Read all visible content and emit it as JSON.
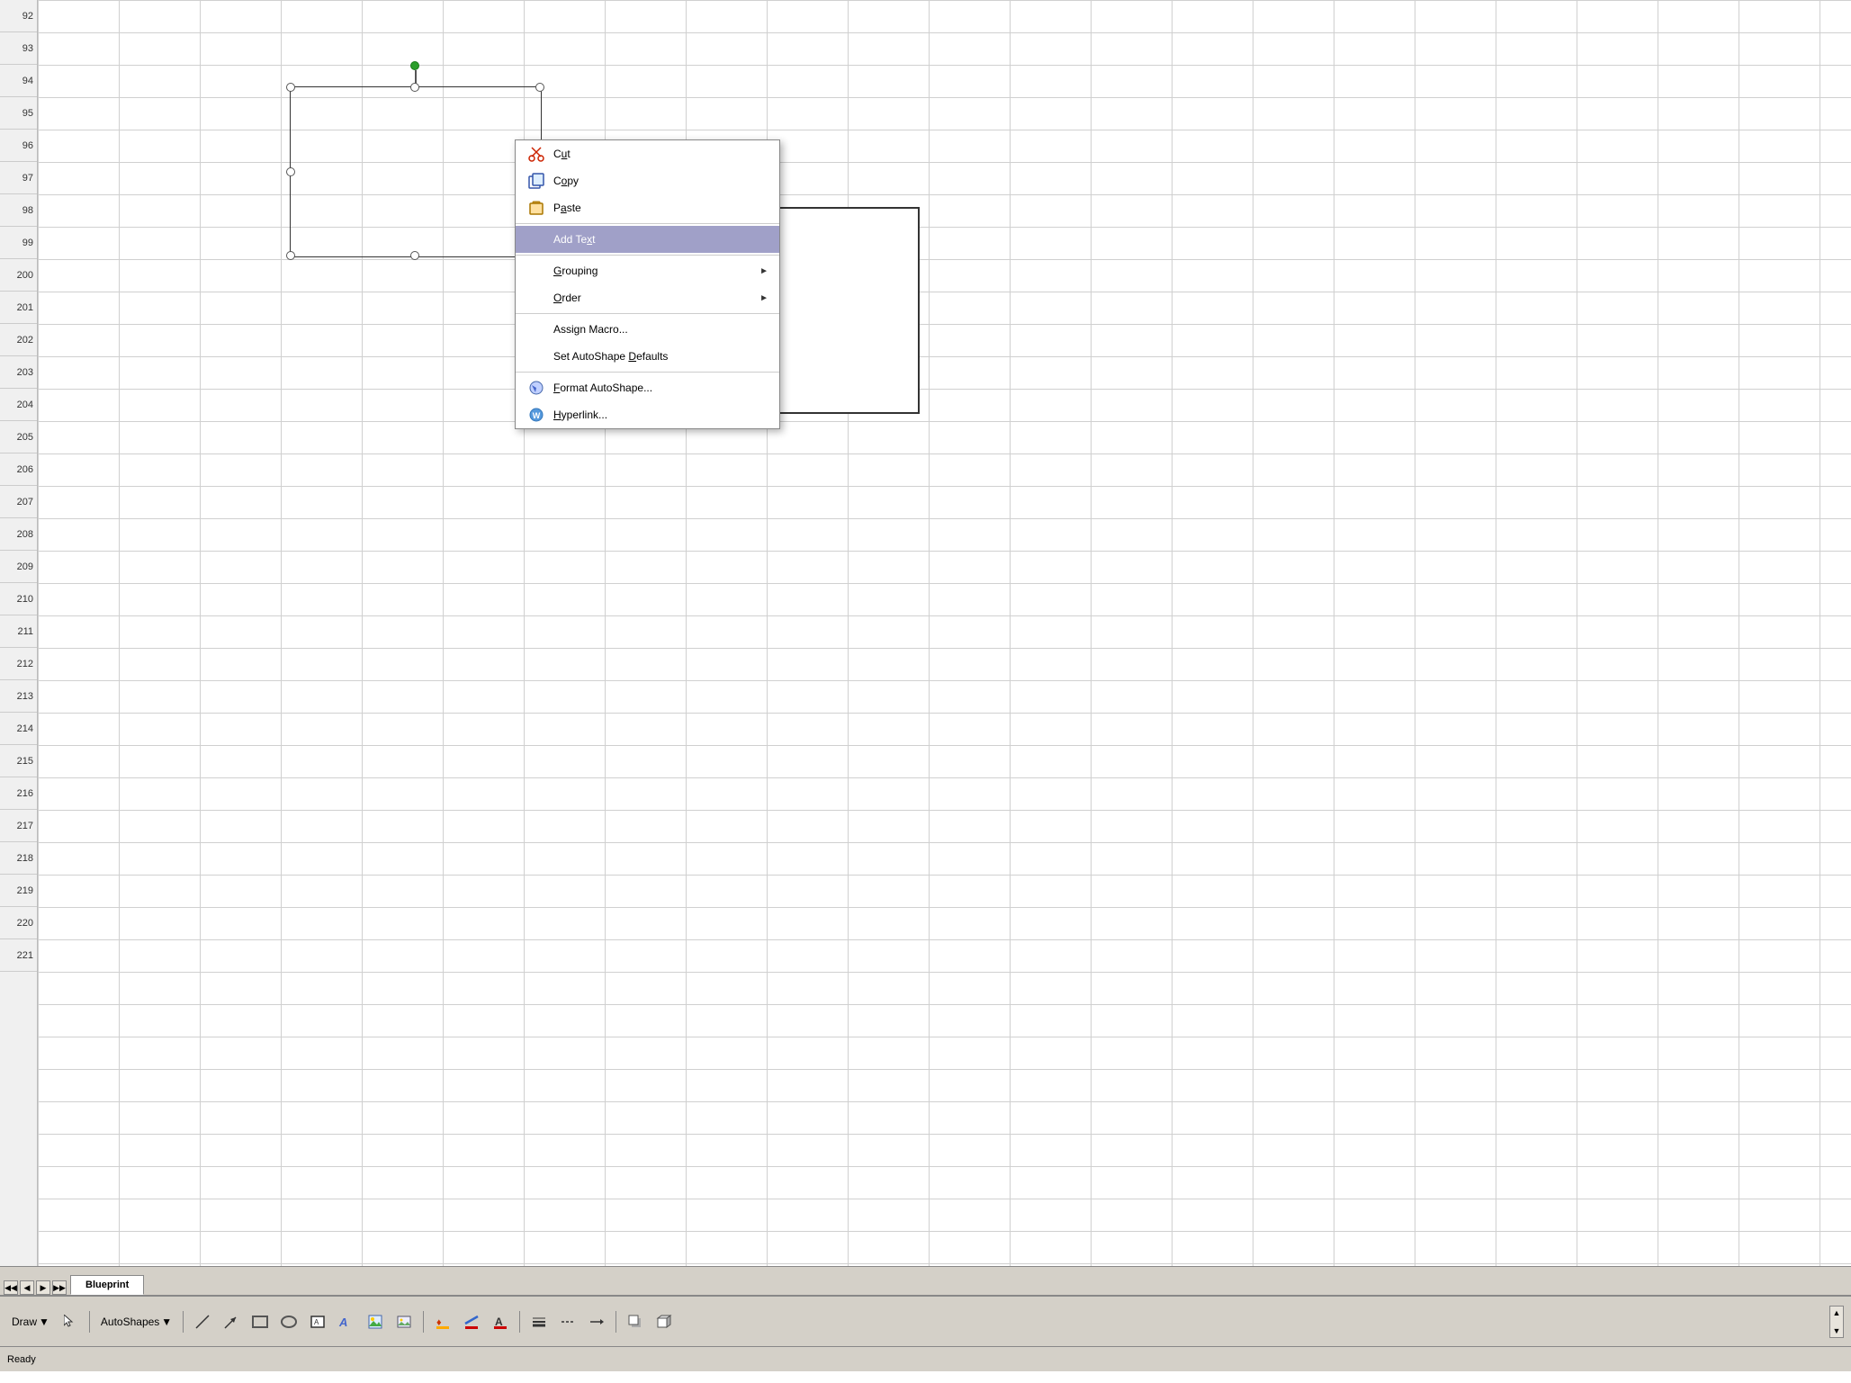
{
  "spreadsheet": {
    "row_start": 92,
    "row_count": 30,
    "rows": [
      "92",
      "93",
      "94",
      "95",
      "96",
      "97",
      "98",
      "99",
      "200",
      "201",
      "202",
      "203",
      "204",
      "205",
      "206",
      "207",
      "208",
      "209",
      "210",
      "211",
      "212",
      "213",
      "214",
      "215",
      "216",
      "217",
      "218",
      "219",
      "220",
      "221"
    ]
  },
  "context_menu": {
    "items": [
      {
        "id": "cut",
        "label": "Cut",
        "has_icon": true,
        "has_arrow": false,
        "highlighted": false,
        "separator_after": false
      },
      {
        "id": "copy",
        "label": "Copy",
        "has_icon": true,
        "has_arrow": false,
        "highlighted": false,
        "separator_after": false
      },
      {
        "id": "paste",
        "label": "Paste",
        "has_icon": true,
        "has_arrow": false,
        "highlighted": false,
        "separator_after": true
      },
      {
        "id": "add-text",
        "label": "Add Text",
        "has_icon": false,
        "has_arrow": false,
        "highlighted": true,
        "separator_after": true
      },
      {
        "id": "grouping",
        "label": "Grouping",
        "has_icon": false,
        "has_arrow": true,
        "highlighted": false,
        "separator_after": false
      },
      {
        "id": "order",
        "label": "Order",
        "has_icon": false,
        "has_arrow": true,
        "highlighted": false,
        "separator_after": true
      },
      {
        "id": "assign-macro",
        "label": "Assign Macro...",
        "has_icon": false,
        "has_arrow": false,
        "highlighted": false,
        "separator_after": false
      },
      {
        "id": "set-autoshape",
        "label": "Set AutoShape Defaults",
        "has_icon": false,
        "has_arrow": false,
        "highlighted": false,
        "separator_after": true
      },
      {
        "id": "format-autoshape",
        "label": "Format AutoShape...",
        "has_icon": true,
        "has_arrow": false,
        "highlighted": false,
        "separator_after": false
      },
      {
        "id": "hyperlink",
        "label": "Hyperlink...",
        "has_icon": true,
        "has_arrow": false,
        "highlighted": false,
        "separator_after": false
      }
    ]
  },
  "sheet_tab": {
    "name": "Blueprint"
  },
  "status_bar": {
    "text": "Ready"
  },
  "toolbar": {
    "draw_label": "Draw",
    "autoshapes_label": "AutoShapes"
  }
}
